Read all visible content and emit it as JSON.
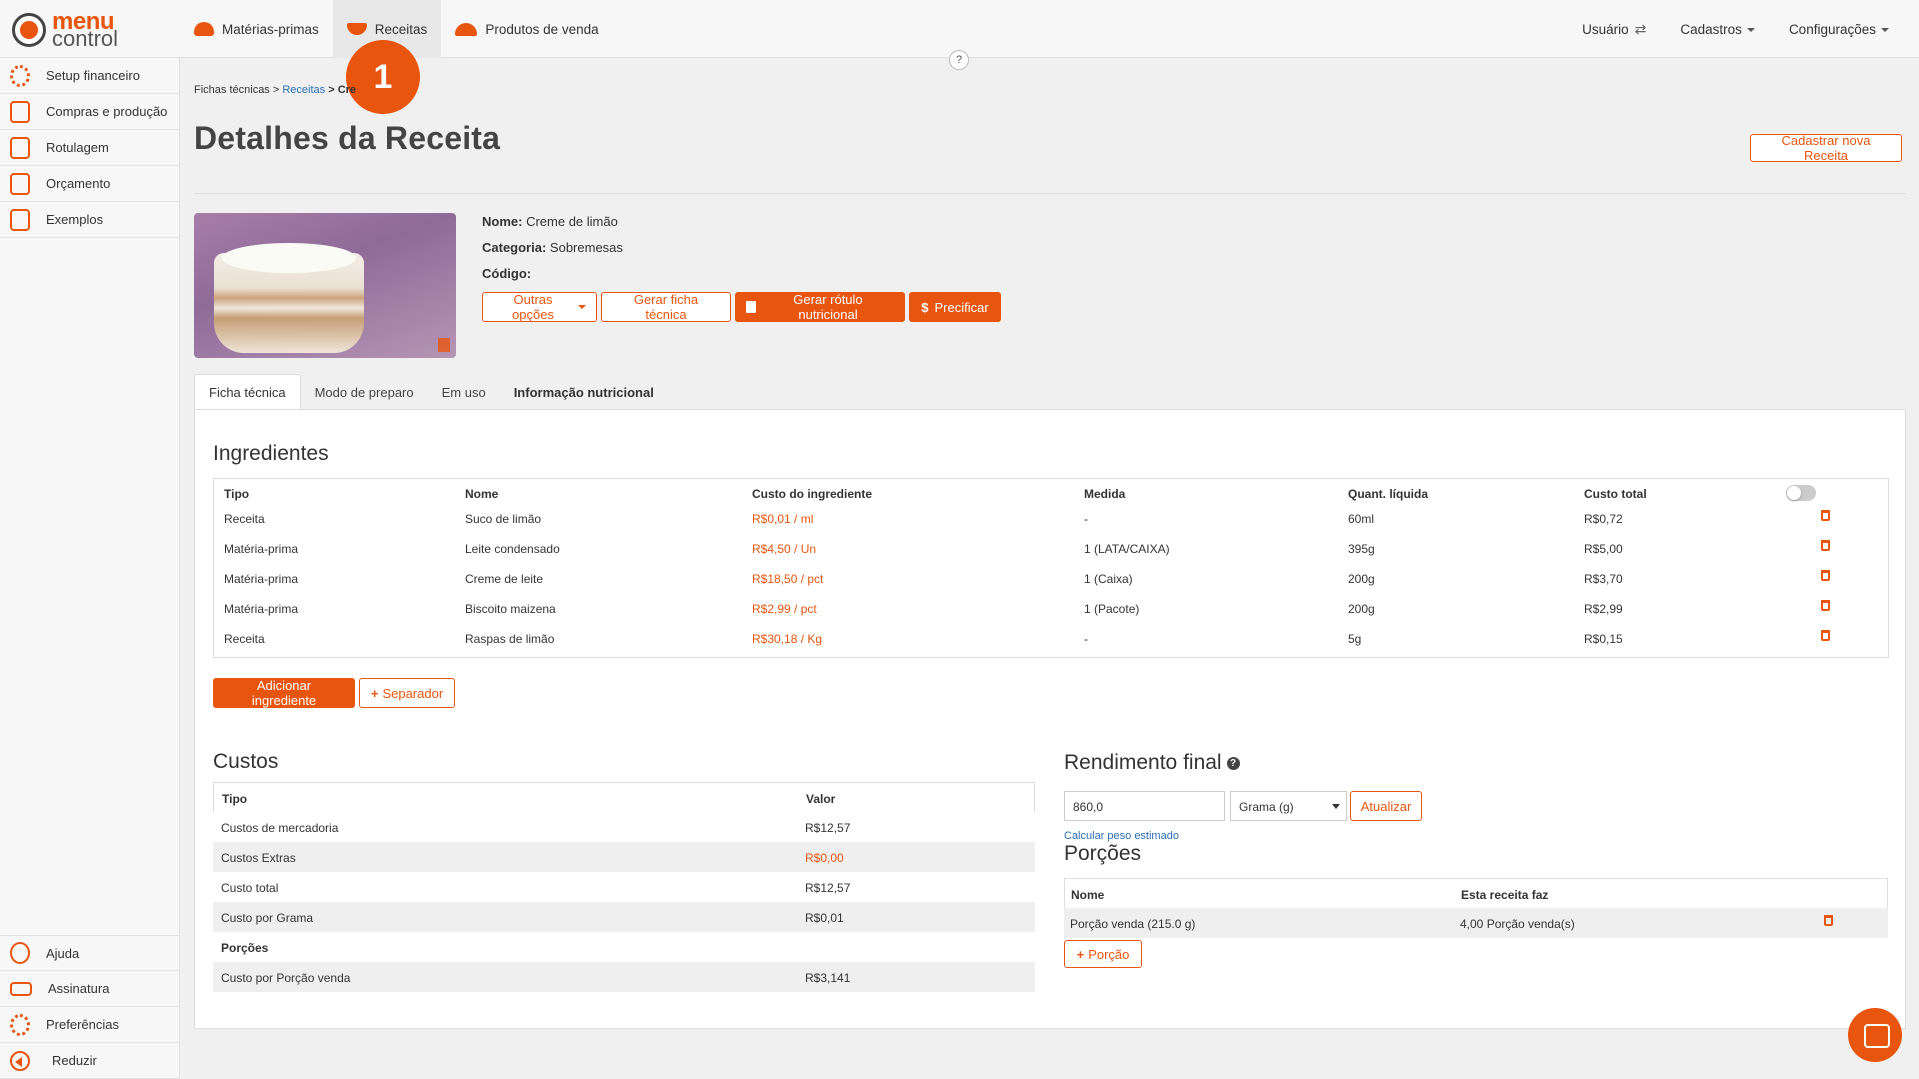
{
  "brand": {
    "line1": "menu",
    "line2": "control"
  },
  "topnav": {
    "items": [
      {
        "label": "Matérias-primas"
      },
      {
        "label": "Receitas"
      },
      {
        "label": "Produtos de venda"
      }
    ]
  },
  "topright": {
    "user": "Usuário",
    "cadastros": "Cadastros",
    "config": "Configurações"
  },
  "help": "?",
  "step_badge": "1",
  "sidebar": {
    "items": [
      {
        "label": "Setup financeiro"
      },
      {
        "label": "Compras e produção"
      },
      {
        "label": "Rotulagem"
      },
      {
        "label": "Orçamento"
      },
      {
        "label": "Exemplos"
      }
    ],
    "bottom": [
      {
        "label": "Ajuda"
      },
      {
        "label": "Assinatura"
      },
      {
        "label": "Preferências"
      },
      {
        "label": "Reduzir"
      }
    ]
  },
  "breadcrumb": {
    "part1": "Fichas técnicas >",
    "part2": "Receitas",
    "part3": "> Cre"
  },
  "page": {
    "title": "Detalhes da Receita",
    "new_button": "Cadastrar nova Receita"
  },
  "recipe": {
    "name_label": "Nome:",
    "name": "Creme de limão",
    "category_label": "Categoria:",
    "category": "Sobremesas",
    "code_label": "Código:",
    "code": ""
  },
  "actions": {
    "other": "Outras opções",
    "sheet": "Gerar ficha técnica",
    "label": "Gerar rótulo nutricional",
    "price": "Precificar",
    "price_symbol": "$"
  },
  "tabs": [
    {
      "label": "Ficha técnica"
    },
    {
      "label": "Modo de preparo"
    },
    {
      "label": "Em uso"
    },
    {
      "label": "Informação nutricional"
    }
  ],
  "ingredients": {
    "title": "Ingredientes",
    "headers": {
      "tipo": "Tipo",
      "nome": "Nome",
      "custo": "Custo do ingrediente",
      "medida": "Medida",
      "quant": "Quant. líquida",
      "total": "Custo total"
    },
    "rows": [
      {
        "tipo": "Receita",
        "nome": "Suco de limão",
        "custo": "R$0,01 / ml",
        "medida": "-",
        "quant": "60ml",
        "total": "R$0,72"
      },
      {
        "tipo": "Matéria-prima",
        "nome": "Leite condensado",
        "custo": "R$4,50 / Un",
        "medida": "1 (LATA/CAIXA)",
        "quant": "395g",
        "total": "R$5,00"
      },
      {
        "tipo": "Matéria-prima",
        "nome": "Creme de leite",
        "custo": "R$18,50 / pct",
        "medida": "1 (Caixa)",
        "quant": "200g",
        "total": "R$3,70"
      },
      {
        "tipo": "Matéria-prima",
        "nome": "Biscoito maizena",
        "custo": "R$2,99 / pct",
        "medida": "1 (Pacote)",
        "quant": "200g",
        "total": "R$2,99"
      },
      {
        "tipo": "Receita",
        "nome": "Raspas de limão",
        "custo": "R$30,18 / Kg",
        "medida": "-",
        "quant": "5g",
        "total": "R$0,15"
      }
    ],
    "add_button": "Adicionar ingrediente",
    "separator_button": "Separador",
    "plus": "+"
  },
  "costs": {
    "title": "Custos",
    "headers": {
      "tipo": "Tipo",
      "valor": "Valor"
    },
    "rows": [
      {
        "k": "Custos de mercadoria",
        "v": "R$12,57"
      },
      {
        "k": "Custos Extras",
        "v": "R$0,00"
      },
      {
        "k": "Custo total",
        "v": "R$12,57"
      },
      {
        "k": "Custo por Grama",
        "v": "R$0,01"
      },
      {
        "k": "Porções",
        "v": ""
      },
      {
        "k": "Custo por Porção venda",
        "v": "R$3,141"
      }
    ]
  },
  "yield": {
    "title": "Rendimento final",
    "q": "?",
    "value": "860,0",
    "unit": "Grama (g)",
    "update": "Atualizar",
    "calc_link": "Calcular peso estimado"
  },
  "portions": {
    "title": "Porções",
    "headers": {
      "nome": "Nome",
      "faz": "Esta receita faz"
    },
    "rows": [
      {
        "nome": "Porção venda (215.0 g)",
        "faz": "4,00 Porção venda(s)"
      }
    ],
    "add_button": "Porção"
  }
}
